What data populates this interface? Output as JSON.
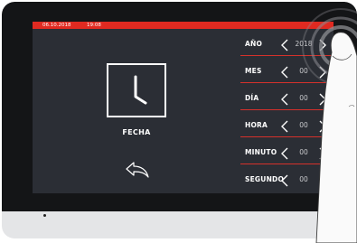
{
  "status_bar": {
    "date": "06.10.2018",
    "time": "19:08"
  },
  "main": {
    "section_title": "FECHA"
  },
  "rows": [
    {
      "label": "AÑO",
      "value": "2018"
    },
    {
      "label": "MES",
      "value": "00"
    },
    {
      "label": "DÍA",
      "value": "00"
    },
    {
      "label": "HORA",
      "value": "00"
    },
    {
      "label": "MINUTO",
      "value": "00"
    },
    {
      "label": "SEGUNDO",
      "value": "00"
    }
  ],
  "colors": {
    "accent": "#e02a21",
    "screen_background": "#2b2e35",
    "bezel": "#141517",
    "text": "#ffffff"
  },
  "icons": {
    "clock": "clock-icon",
    "back": "back-arrow-icon",
    "decrease": "chevron-left-icon",
    "increase": "chevron-right-icon",
    "touch": "tap-ripple-icon"
  }
}
